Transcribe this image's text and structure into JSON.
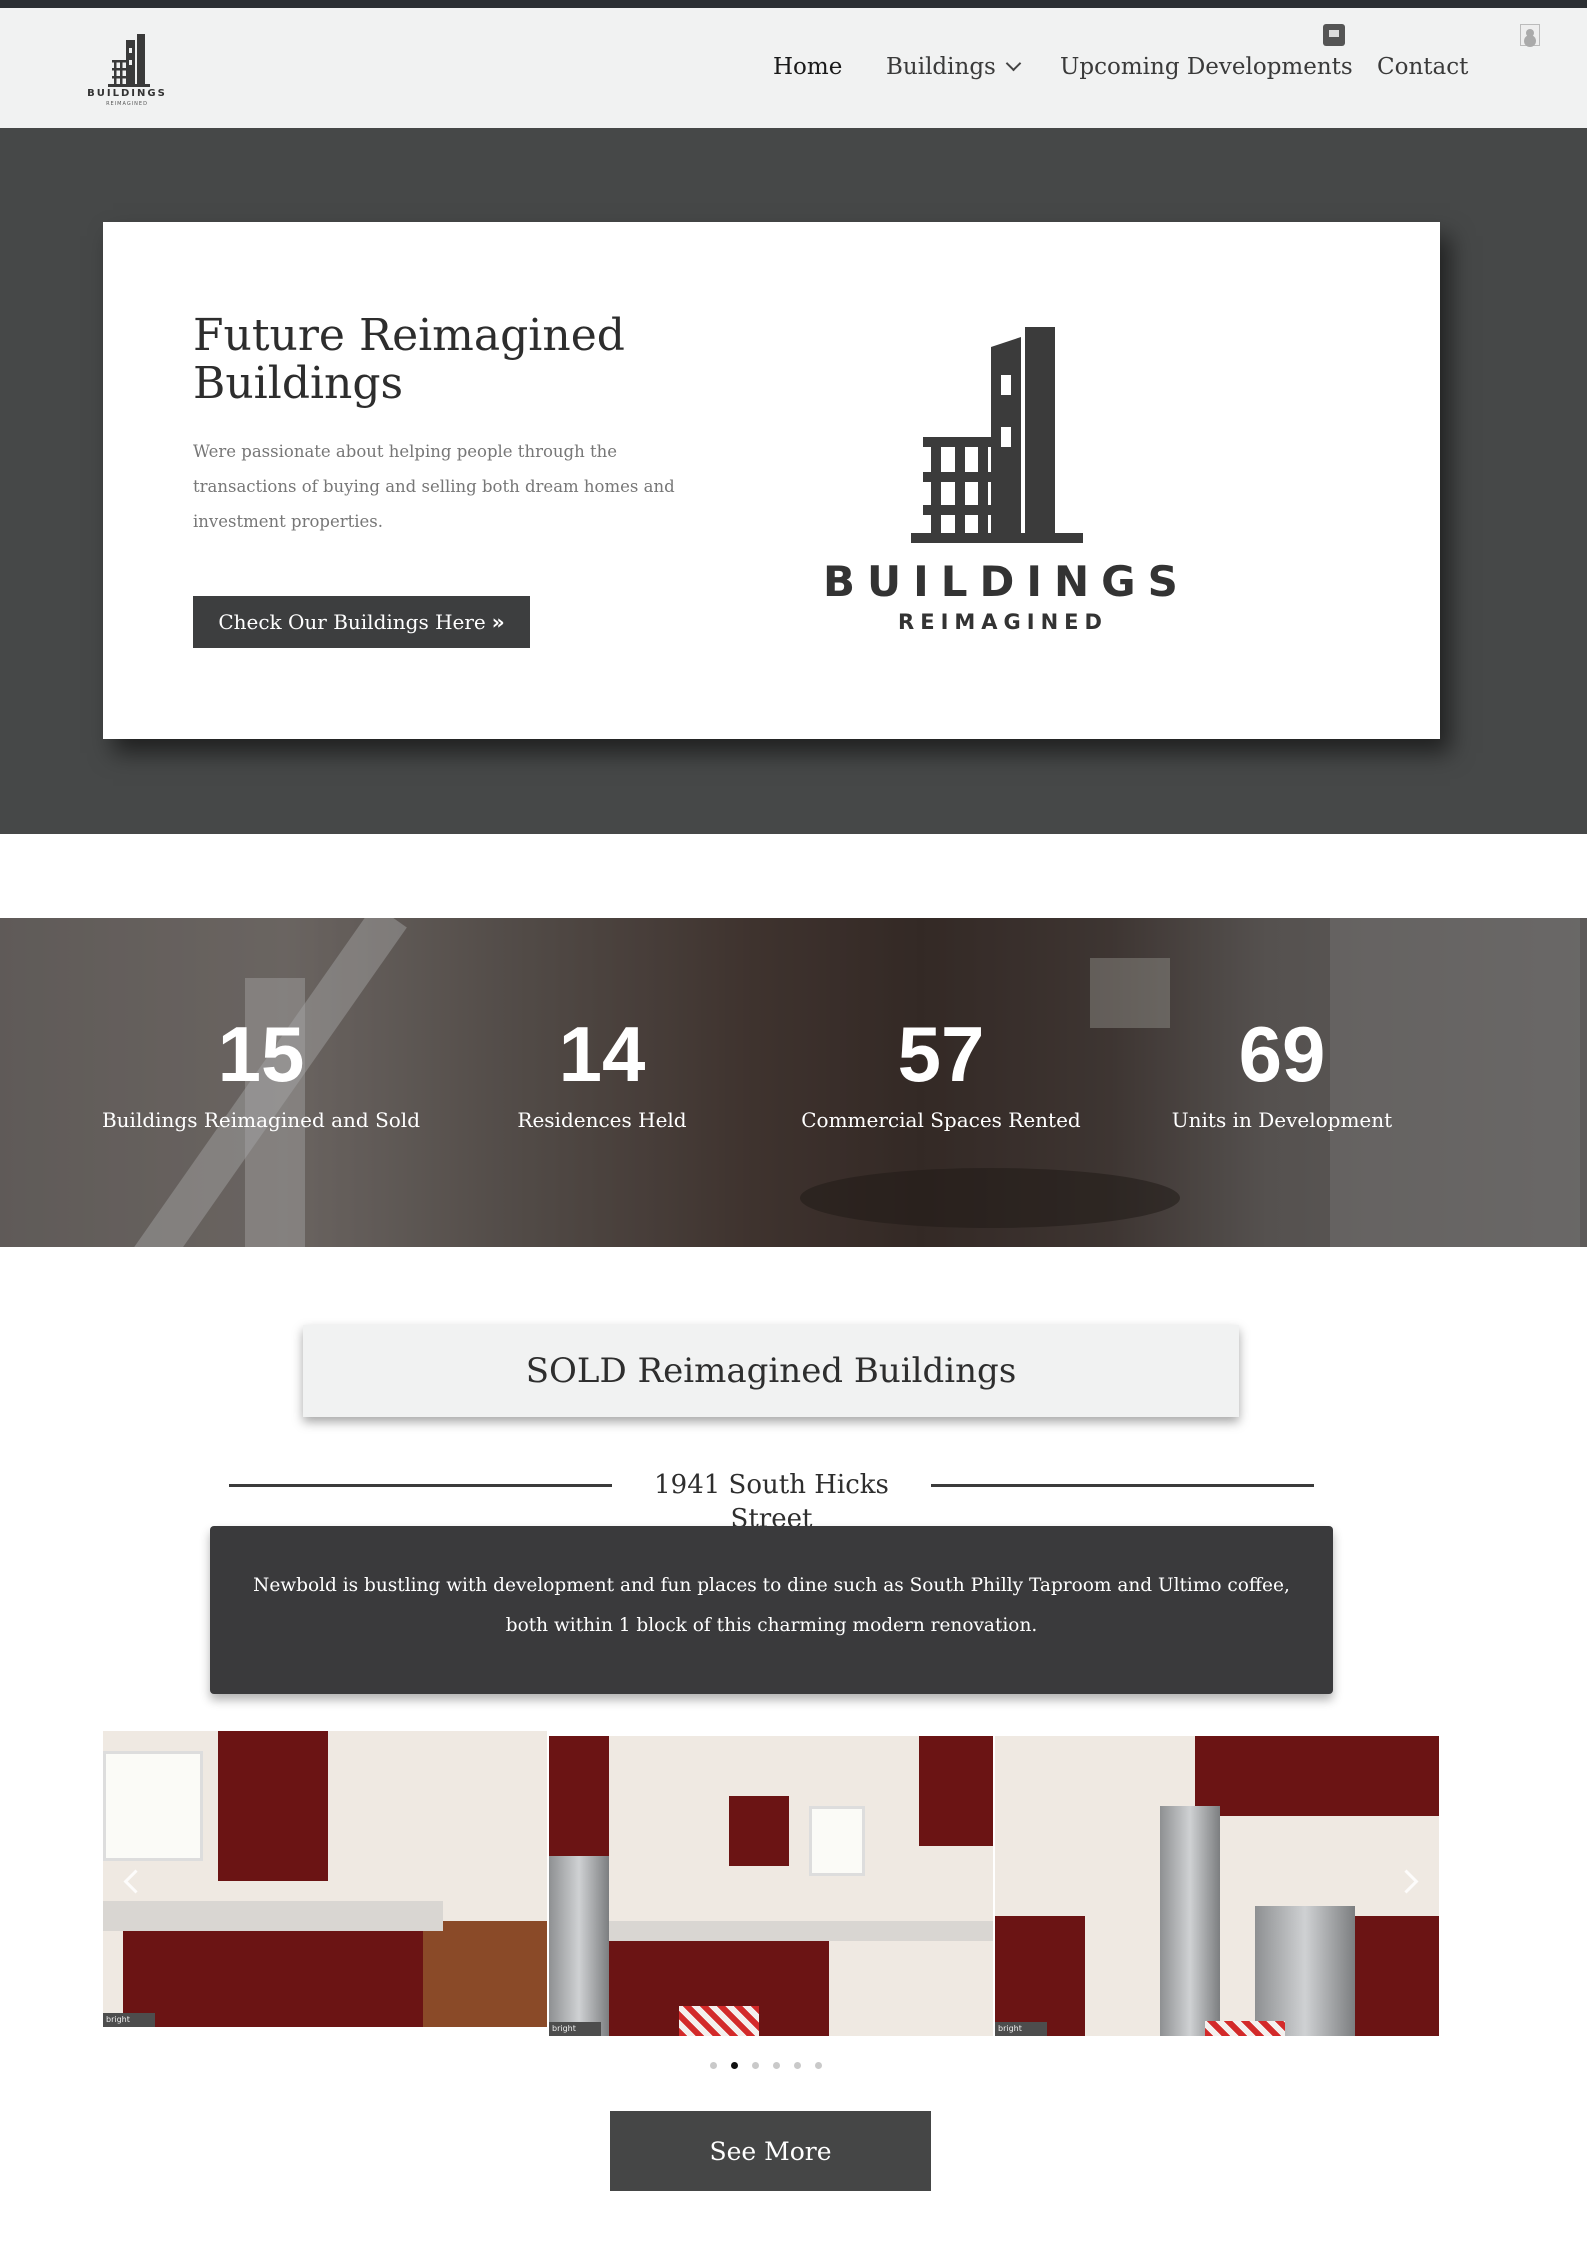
{
  "header": {
    "logo_word": "BUILDINGS",
    "logo_sub": "REIMAGINED",
    "nav": [
      {
        "label": "Home"
      },
      {
        "label": "Buildings"
      },
      {
        "label": "Upcoming Developments"
      },
      {
        "label": "Contact"
      }
    ]
  },
  "hero": {
    "title": "Future Reimagined Buildings",
    "description": "Were passionate about helping people through the transactions of buying and selling both dream homes and investment properties.",
    "button_label": "Check Our Buildings Here",
    "button_icon": "double-chevron-right-icon",
    "logo_word": "BUILDINGS",
    "logo_sub": "REIMAGINED"
  },
  "stats": [
    {
      "value": "15",
      "label": "Buildings Reimagined and Sold"
    },
    {
      "value": "14",
      "label": "Residences Held"
    },
    {
      "value": "57",
      "label": "Commercial Spaces Rented"
    },
    {
      "value": "69",
      "label": "Units in Development"
    }
  ],
  "sold": {
    "title": "SOLD Reimagined Buildings",
    "address": "1941 South Hicks Street",
    "description": "Newbold is bustling with development and fun places to dine such as South Philly Taproom and Ultimo coffee, both within 1 block of this charming modern renovation.",
    "carousel": {
      "slides": [
        {
          "alt": "kitchen with red cabinets and dining area",
          "badge": "bright"
        },
        {
          "alt": "kitchen with stainless appliances and back door",
          "badge": "bright"
        },
        {
          "alt": "kitchen with staircase and stove",
          "badge": "bright"
        }
      ],
      "dot_count": 6,
      "active_dot": 2
    },
    "see_more_label": "See More"
  },
  "colors": {
    "header_bg": "#f1f2f2",
    "hero_bg": "#464848",
    "button_bg": "#3d3e3f",
    "desc_box_bg": "#3a3a3c",
    "cabinet_red": "#6b1414"
  }
}
